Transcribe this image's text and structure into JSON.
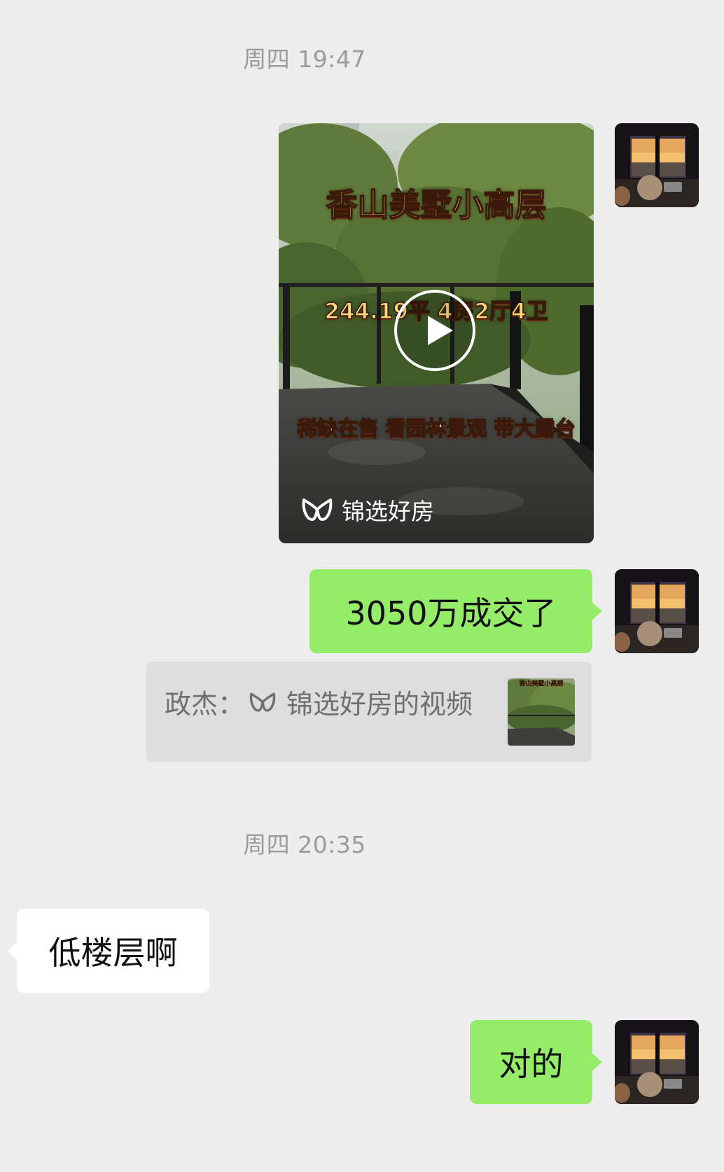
{
  "chat": {
    "timestamps": [
      "周四 19:47",
      "周四 20:35"
    ],
    "video_message": {
      "title_line1": "香山美墅小高层",
      "title_line2": "244.19平 4房2厅4卫",
      "title_line3": "稀缺在售 看园林景观 带大露台",
      "channel_name": "锦选好房",
      "play_icon": "play-icon"
    },
    "messages": [
      {
        "side": "right",
        "text": "3050万成交了"
      },
      {
        "side": "left",
        "text": "低楼层啊"
      },
      {
        "side": "right",
        "text": "对的"
      }
    ],
    "quote": {
      "sender": "政杰：",
      "content": "锦选好房的视频",
      "thumb_caption": "香山美墅小高层"
    }
  },
  "colors": {
    "background": "#ededed",
    "sent_bubble": "#95ec69",
    "received_bubble": "#ffffff",
    "timestamp_text": "#9b9b9b",
    "quote_background": "#dedede"
  }
}
